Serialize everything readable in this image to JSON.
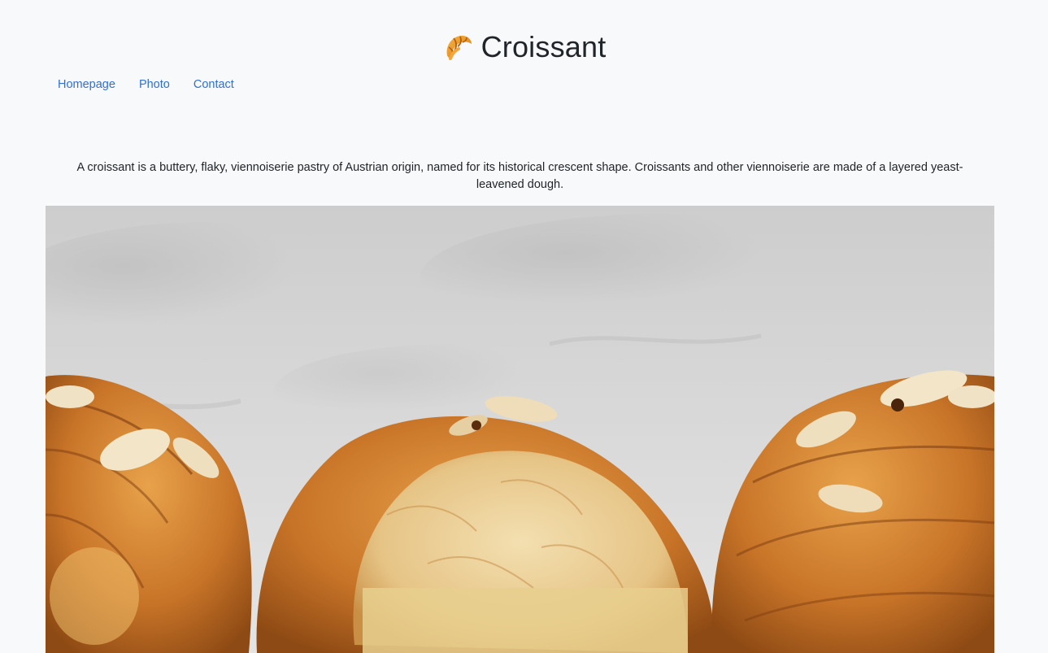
{
  "site": {
    "title": "Croissant",
    "logo_icon": "croissant-icon"
  },
  "nav": {
    "items": [
      {
        "label": "Homepage"
      },
      {
        "label": "Photo"
      },
      {
        "label": "Contact"
      }
    ]
  },
  "intro": {
    "text": "A croissant is a buttery, flaky, viennoiserie pastry of Austrian origin, named for its historical crescent shape. Croissants and other viennoiserie are made of a layered yeast-leavened dough."
  },
  "hero": {
    "image_subject": "croissant-photo"
  },
  "colors": {
    "background": "#f8f9fb",
    "link": "#2f6fd6",
    "text": "#212529"
  }
}
